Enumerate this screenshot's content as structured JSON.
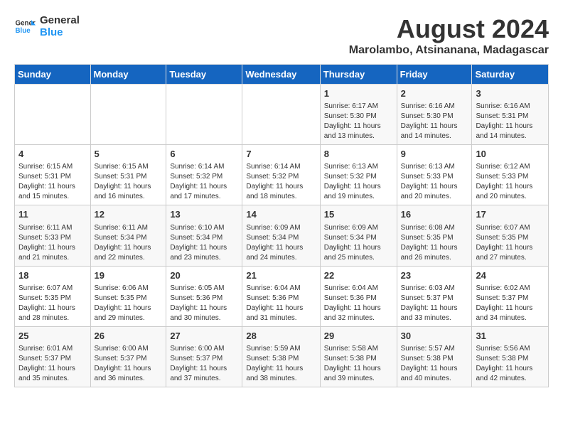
{
  "logo": {
    "line1": "General",
    "line2": "Blue"
  },
  "title": "August 2024",
  "subtitle": "Marolambo, Atsinanana, Madagascar",
  "days_of_week": [
    "Sunday",
    "Monday",
    "Tuesday",
    "Wednesday",
    "Thursday",
    "Friday",
    "Saturday"
  ],
  "weeks": [
    [
      {
        "day": "",
        "info": ""
      },
      {
        "day": "",
        "info": ""
      },
      {
        "day": "",
        "info": ""
      },
      {
        "day": "",
        "info": ""
      },
      {
        "day": "1",
        "info": "Sunrise: 6:17 AM\nSunset: 5:30 PM\nDaylight: 11 hours\nand 13 minutes."
      },
      {
        "day": "2",
        "info": "Sunrise: 6:16 AM\nSunset: 5:30 PM\nDaylight: 11 hours\nand 14 minutes."
      },
      {
        "day": "3",
        "info": "Sunrise: 6:16 AM\nSunset: 5:31 PM\nDaylight: 11 hours\nand 14 minutes."
      }
    ],
    [
      {
        "day": "4",
        "info": "Sunrise: 6:15 AM\nSunset: 5:31 PM\nDaylight: 11 hours\nand 15 minutes."
      },
      {
        "day": "5",
        "info": "Sunrise: 6:15 AM\nSunset: 5:31 PM\nDaylight: 11 hours\nand 16 minutes."
      },
      {
        "day": "6",
        "info": "Sunrise: 6:14 AM\nSunset: 5:32 PM\nDaylight: 11 hours\nand 17 minutes."
      },
      {
        "day": "7",
        "info": "Sunrise: 6:14 AM\nSunset: 5:32 PM\nDaylight: 11 hours\nand 18 minutes."
      },
      {
        "day": "8",
        "info": "Sunrise: 6:13 AM\nSunset: 5:32 PM\nDaylight: 11 hours\nand 19 minutes."
      },
      {
        "day": "9",
        "info": "Sunrise: 6:13 AM\nSunset: 5:33 PM\nDaylight: 11 hours\nand 20 minutes."
      },
      {
        "day": "10",
        "info": "Sunrise: 6:12 AM\nSunset: 5:33 PM\nDaylight: 11 hours\nand 20 minutes."
      }
    ],
    [
      {
        "day": "11",
        "info": "Sunrise: 6:11 AM\nSunset: 5:33 PM\nDaylight: 11 hours\nand 21 minutes."
      },
      {
        "day": "12",
        "info": "Sunrise: 6:11 AM\nSunset: 5:34 PM\nDaylight: 11 hours\nand 22 minutes."
      },
      {
        "day": "13",
        "info": "Sunrise: 6:10 AM\nSunset: 5:34 PM\nDaylight: 11 hours\nand 23 minutes."
      },
      {
        "day": "14",
        "info": "Sunrise: 6:09 AM\nSunset: 5:34 PM\nDaylight: 11 hours\nand 24 minutes."
      },
      {
        "day": "15",
        "info": "Sunrise: 6:09 AM\nSunset: 5:34 PM\nDaylight: 11 hours\nand 25 minutes."
      },
      {
        "day": "16",
        "info": "Sunrise: 6:08 AM\nSunset: 5:35 PM\nDaylight: 11 hours\nand 26 minutes."
      },
      {
        "day": "17",
        "info": "Sunrise: 6:07 AM\nSunset: 5:35 PM\nDaylight: 11 hours\nand 27 minutes."
      }
    ],
    [
      {
        "day": "18",
        "info": "Sunrise: 6:07 AM\nSunset: 5:35 PM\nDaylight: 11 hours\nand 28 minutes."
      },
      {
        "day": "19",
        "info": "Sunrise: 6:06 AM\nSunset: 5:35 PM\nDaylight: 11 hours\nand 29 minutes."
      },
      {
        "day": "20",
        "info": "Sunrise: 6:05 AM\nSunset: 5:36 PM\nDaylight: 11 hours\nand 30 minutes."
      },
      {
        "day": "21",
        "info": "Sunrise: 6:04 AM\nSunset: 5:36 PM\nDaylight: 11 hours\nand 31 minutes."
      },
      {
        "day": "22",
        "info": "Sunrise: 6:04 AM\nSunset: 5:36 PM\nDaylight: 11 hours\nand 32 minutes."
      },
      {
        "day": "23",
        "info": "Sunrise: 6:03 AM\nSunset: 5:37 PM\nDaylight: 11 hours\nand 33 minutes."
      },
      {
        "day": "24",
        "info": "Sunrise: 6:02 AM\nSunset: 5:37 PM\nDaylight: 11 hours\nand 34 minutes."
      }
    ],
    [
      {
        "day": "25",
        "info": "Sunrise: 6:01 AM\nSunset: 5:37 PM\nDaylight: 11 hours\nand 35 minutes."
      },
      {
        "day": "26",
        "info": "Sunrise: 6:00 AM\nSunset: 5:37 PM\nDaylight: 11 hours\nand 36 minutes."
      },
      {
        "day": "27",
        "info": "Sunrise: 6:00 AM\nSunset: 5:37 PM\nDaylight: 11 hours\nand 37 minutes."
      },
      {
        "day": "28",
        "info": "Sunrise: 5:59 AM\nSunset: 5:38 PM\nDaylight: 11 hours\nand 38 minutes."
      },
      {
        "day": "29",
        "info": "Sunrise: 5:58 AM\nSunset: 5:38 PM\nDaylight: 11 hours\nand 39 minutes."
      },
      {
        "day": "30",
        "info": "Sunrise: 5:57 AM\nSunset: 5:38 PM\nDaylight: 11 hours\nand 40 minutes."
      },
      {
        "day": "31",
        "info": "Sunrise: 5:56 AM\nSunset: 5:38 PM\nDaylight: 11 hours\nand 42 minutes."
      }
    ]
  ]
}
